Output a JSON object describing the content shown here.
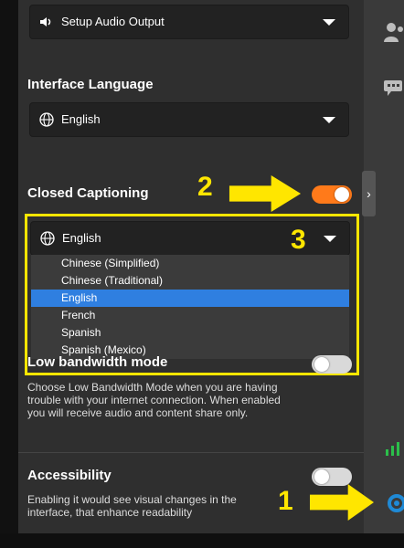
{
  "audio_output": {
    "label": "Setup Audio Output",
    "icon": "speaker-icon"
  },
  "interface_language": {
    "title": "Interface Language",
    "selected": "English",
    "icon": "globe-icon"
  },
  "closed_captioning": {
    "title": "Closed Captioning",
    "toggle_state": "on",
    "selected": "English",
    "icon": "globe-icon",
    "options": [
      "Chinese (Simplified)",
      "Chinese (Traditional)",
      "English",
      "French",
      "Spanish",
      "Spanish (Mexico)"
    ],
    "selected_index": 2
  },
  "low_bandwidth": {
    "title": "Low bandwidth mode",
    "toggle_state": "off",
    "description_lines": [
      "Choose Low Bandwidth Mode when you are having",
      "trouble with your internet connection. When enabled",
      "you will receive audio and content share only."
    ]
  },
  "accessibility": {
    "title": "Accessibility",
    "toggle_state": "off",
    "description_lines": [
      "Enabling it would see visual changes in the",
      "interface, that enhance readability"
    ]
  },
  "annotations": {
    "one": "1",
    "two": "2",
    "three": "3",
    "color": "#ffe600"
  },
  "right_rail": {
    "icons": [
      "people-icon",
      "chat-icon",
      "signal-bars-icon",
      "gear-icon"
    ],
    "expand_label": "›"
  },
  "colors": {
    "accent_orange": "#ff7a1a",
    "selection_blue": "#2f7fe0",
    "gear_blue": "#1f8ad6",
    "signal_green": "#2bbf4a"
  }
}
